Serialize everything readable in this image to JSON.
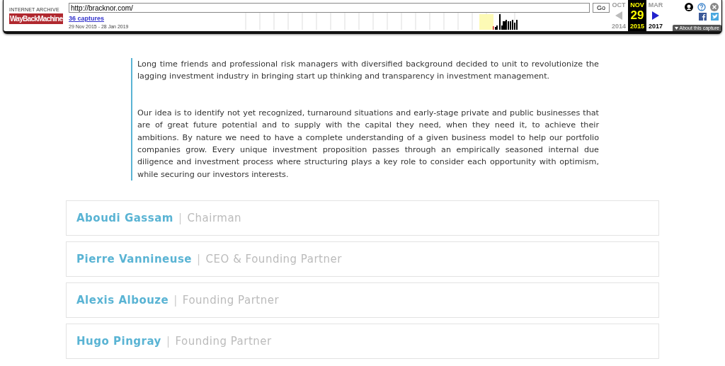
{
  "wayback": {
    "logo_top": "INTERNET ARCHIVE",
    "logo": "WayBackMachine",
    "url": "http://bracknor.com/",
    "go": "Go",
    "captures": "36 captures",
    "range": "29 Nov 2015 - 28 Jan 2019",
    "months": [
      {
        "month": "OCT",
        "year": "2014",
        "selected": false
      },
      {
        "month": "NOV",
        "day": "29",
        "year": "2015",
        "selected": true
      },
      {
        "month": "MAR",
        "year": "2017",
        "selected": false
      }
    ],
    "about": "About this capture"
  },
  "paragraphs": [
    "Long time friends and professional risk managers with diversified background decided to unit to revolutionize the lagging investment industry in bringing start up thinking and transparency in investment management.",
    "Our idea is to identify not yet recognized, turnaround situations and early-stage private and public businesses that are of great future potential and to supply with the capital they need, when they need it, to achieve their ambitions. By nature we need to have a complete understanding of a given business model to help our portfolio companies grow. Every unique investment proposition passes through an empirically seasoned internal due diligence and investment process where structuring plays a key role to consider each opportunity with optimism, while securing our investors interests."
  ],
  "team": [
    {
      "name": "Aboudi Gassam",
      "separator": "|",
      "role": "Chairman"
    },
    {
      "name": "Pierre Vannineuse",
      "separator": "|",
      "role": "CEO & Founding Partner"
    },
    {
      "name": "Alexis Albouze",
      "separator": "|",
      "role": "Founding Partner"
    },
    {
      "name": "Hugo Pingray",
      "separator": "|",
      "role": "Founding Partner"
    }
  ]
}
